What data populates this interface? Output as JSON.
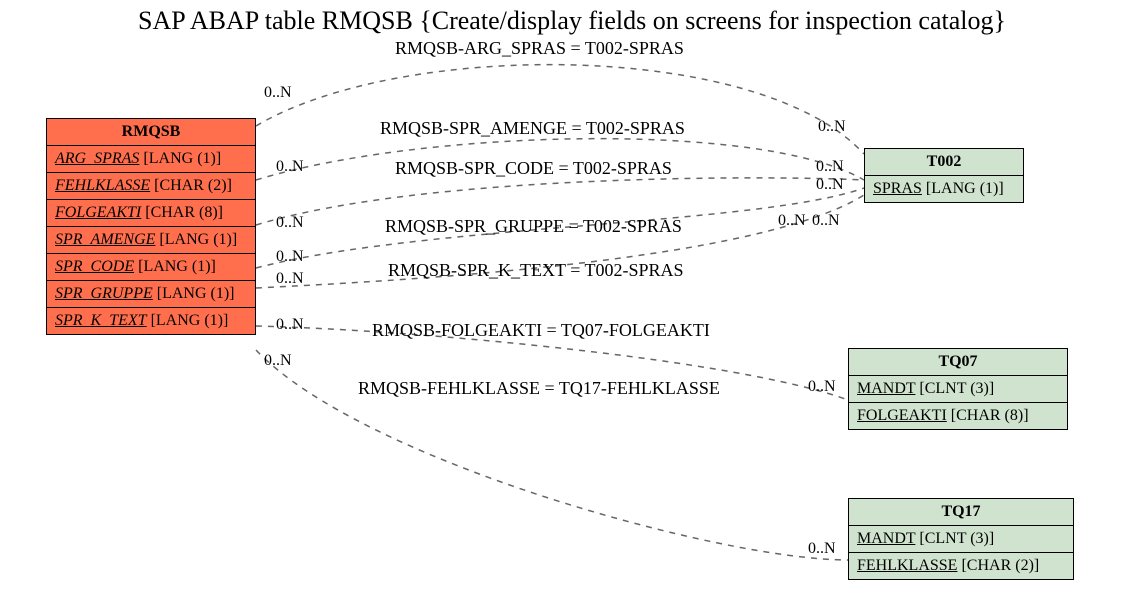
{
  "title": "SAP ABAP table RMQSB {Create/display fields on screens for inspection catalog}",
  "tables": {
    "rmqsb": {
      "name": "RMQSB",
      "fields": [
        {
          "name": "ARG_SPRAS",
          "type": "[LANG (1)]"
        },
        {
          "name": "FEHLKLASSE",
          "type": "[CHAR (2)]"
        },
        {
          "name": "FOLGEAKTI",
          "type": "[CHAR (8)]"
        },
        {
          "name": "SPR_AMENGE",
          "type": "[LANG (1)]"
        },
        {
          "name": "SPR_CODE",
          "type": "[LANG (1)]"
        },
        {
          "name": "SPR_GRUPPE",
          "type": "[LANG (1)]"
        },
        {
          "name": "SPR_K_TEXT",
          "type": "[LANG (1)]"
        }
      ]
    },
    "t002": {
      "name": "T002",
      "fields": [
        {
          "name": "SPRAS",
          "type": "[LANG (1)]"
        }
      ]
    },
    "tq07": {
      "name": "TQ07",
      "fields": [
        {
          "name": "MANDT",
          "type": "[CLNT (3)]"
        },
        {
          "name": "FOLGEAKTI",
          "type": "[CHAR (8)]"
        }
      ]
    },
    "tq17": {
      "name": "TQ17",
      "fields": [
        {
          "name": "MANDT",
          "type": "[CLNT (3)]"
        },
        {
          "name": "FEHLKLASSE",
          "type": "[CHAR (2)]"
        }
      ]
    }
  },
  "relations": [
    {
      "label": "RMQSB-ARG_SPRAS = T002-SPRAS",
      "left_card": "0..N",
      "right_card": "0..N"
    },
    {
      "label": "RMQSB-SPR_AMENGE = T002-SPRAS",
      "left_card": "0..N",
      "right_card": "0..N"
    },
    {
      "label": "RMQSB-SPR_CODE = T002-SPRAS",
      "left_card": "0..N",
      "right_card": "0..N"
    },
    {
      "label": "RMQSB-SPR_GRUPPE = T002-SPRAS",
      "left_card": "0..N",
      "right_card": "0..N"
    },
    {
      "label": "RMQSB-SPR_K_TEXT = T002-SPRAS",
      "left_card": "0..N",
      "right_card": "0..N"
    },
    {
      "label": "RMQSB-FOLGEAKTI = TQ07-FOLGEAKTI",
      "left_card": "0..N",
      "right_card": "0..N"
    },
    {
      "label": "RMQSB-FEHLKLASSE = TQ17-FEHLKLASSE",
      "left_card": "0..N",
      "right_card": "0..N"
    }
  ]
}
